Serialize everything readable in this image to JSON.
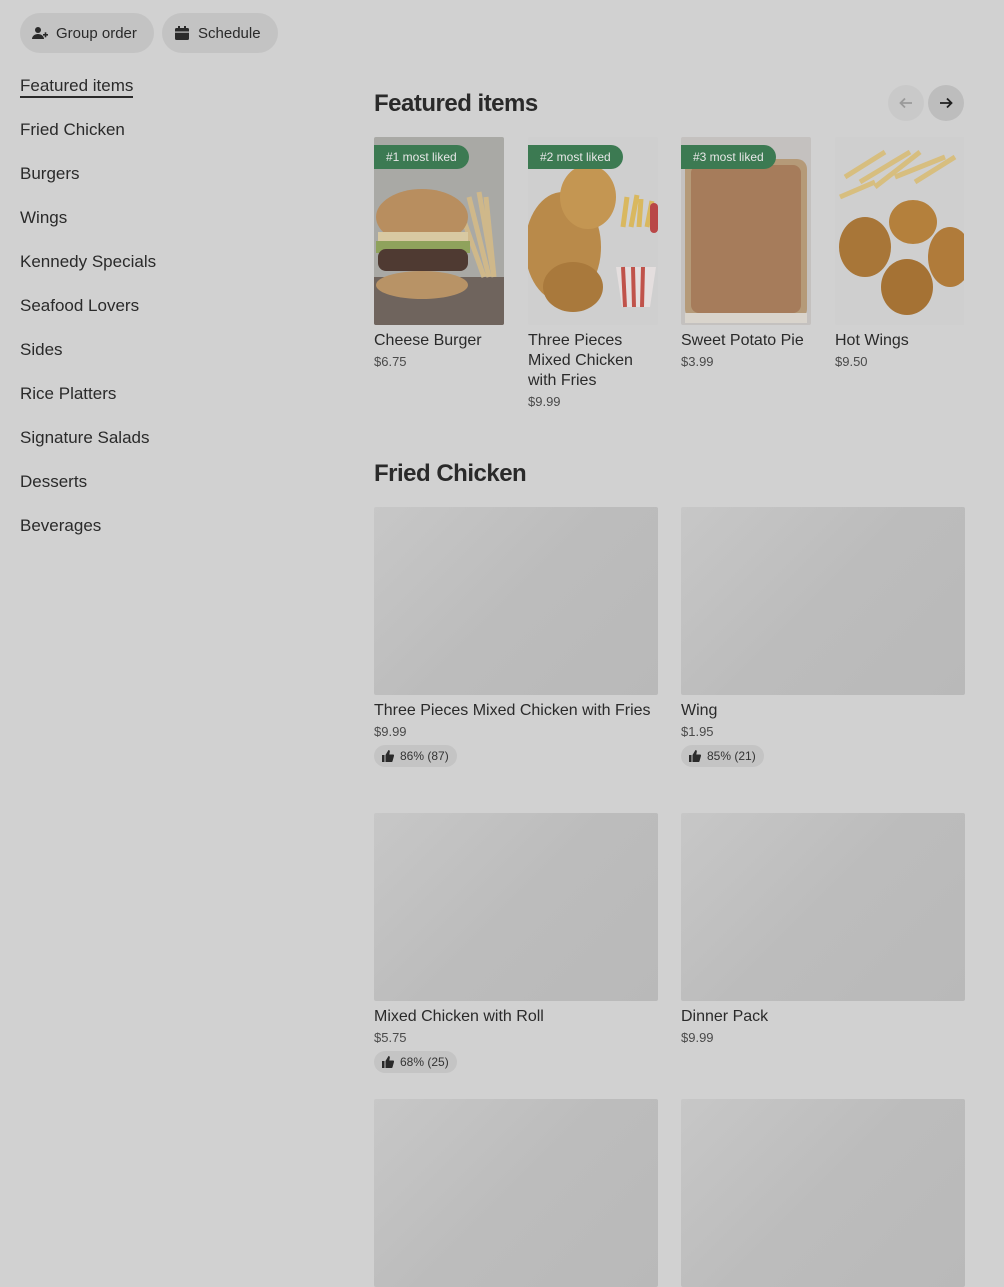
{
  "top_buttons": {
    "group_order": "Group order",
    "schedule": "Schedule"
  },
  "sidebar": {
    "items": [
      {
        "label": "Featured items",
        "active": true
      },
      {
        "label": "Fried Chicken"
      },
      {
        "label": "Burgers"
      },
      {
        "label": "Wings"
      },
      {
        "label": "Kennedy Specials"
      },
      {
        "label": "Seafood Lovers"
      },
      {
        "label": "Sides"
      },
      {
        "label": "Rice Platters"
      },
      {
        "label": "Signature Salads"
      },
      {
        "label": "Desserts"
      },
      {
        "label": "Beverages"
      }
    ]
  },
  "featured": {
    "title": "Featured items",
    "items": [
      {
        "badge": "#1 most liked",
        "name": "Cheese Burger",
        "price": "$6.75",
        "image": "cheese-burger-photo"
      },
      {
        "badge": "#2 most liked",
        "name": "Three Pieces Mixed Chicken with Fries",
        "price": "$9.99",
        "image": "fried-chicken-fries-photo"
      },
      {
        "badge": "#3 most liked",
        "name": "Sweet Potato Pie",
        "price": "$3.99",
        "image": "sweet-potato-pie-photo"
      },
      {
        "name": "Hot Wings",
        "price": "$9.50",
        "image": "hot-wings-photo"
      }
    ]
  },
  "fried_chicken": {
    "title": "Fried Chicken",
    "items": [
      {
        "name": "Three Pieces Mixed Chicken with Fries",
        "price": "$9.99",
        "rating": "86% (87)"
      },
      {
        "name": "Wing",
        "price": "$1.95",
        "rating": "85% (21)"
      },
      {
        "name": "Mixed Chicken with Roll",
        "price": "$5.75",
        "rating": "68% (25)"
      },
      {
        "name": "Dinner Pack",
        "price": "$9.99"
      }
    ]
  },
  "colors": {
    "badge_green": "#3c7a52",
    "overlay_gray": "#d1d1d1"
  }
}
